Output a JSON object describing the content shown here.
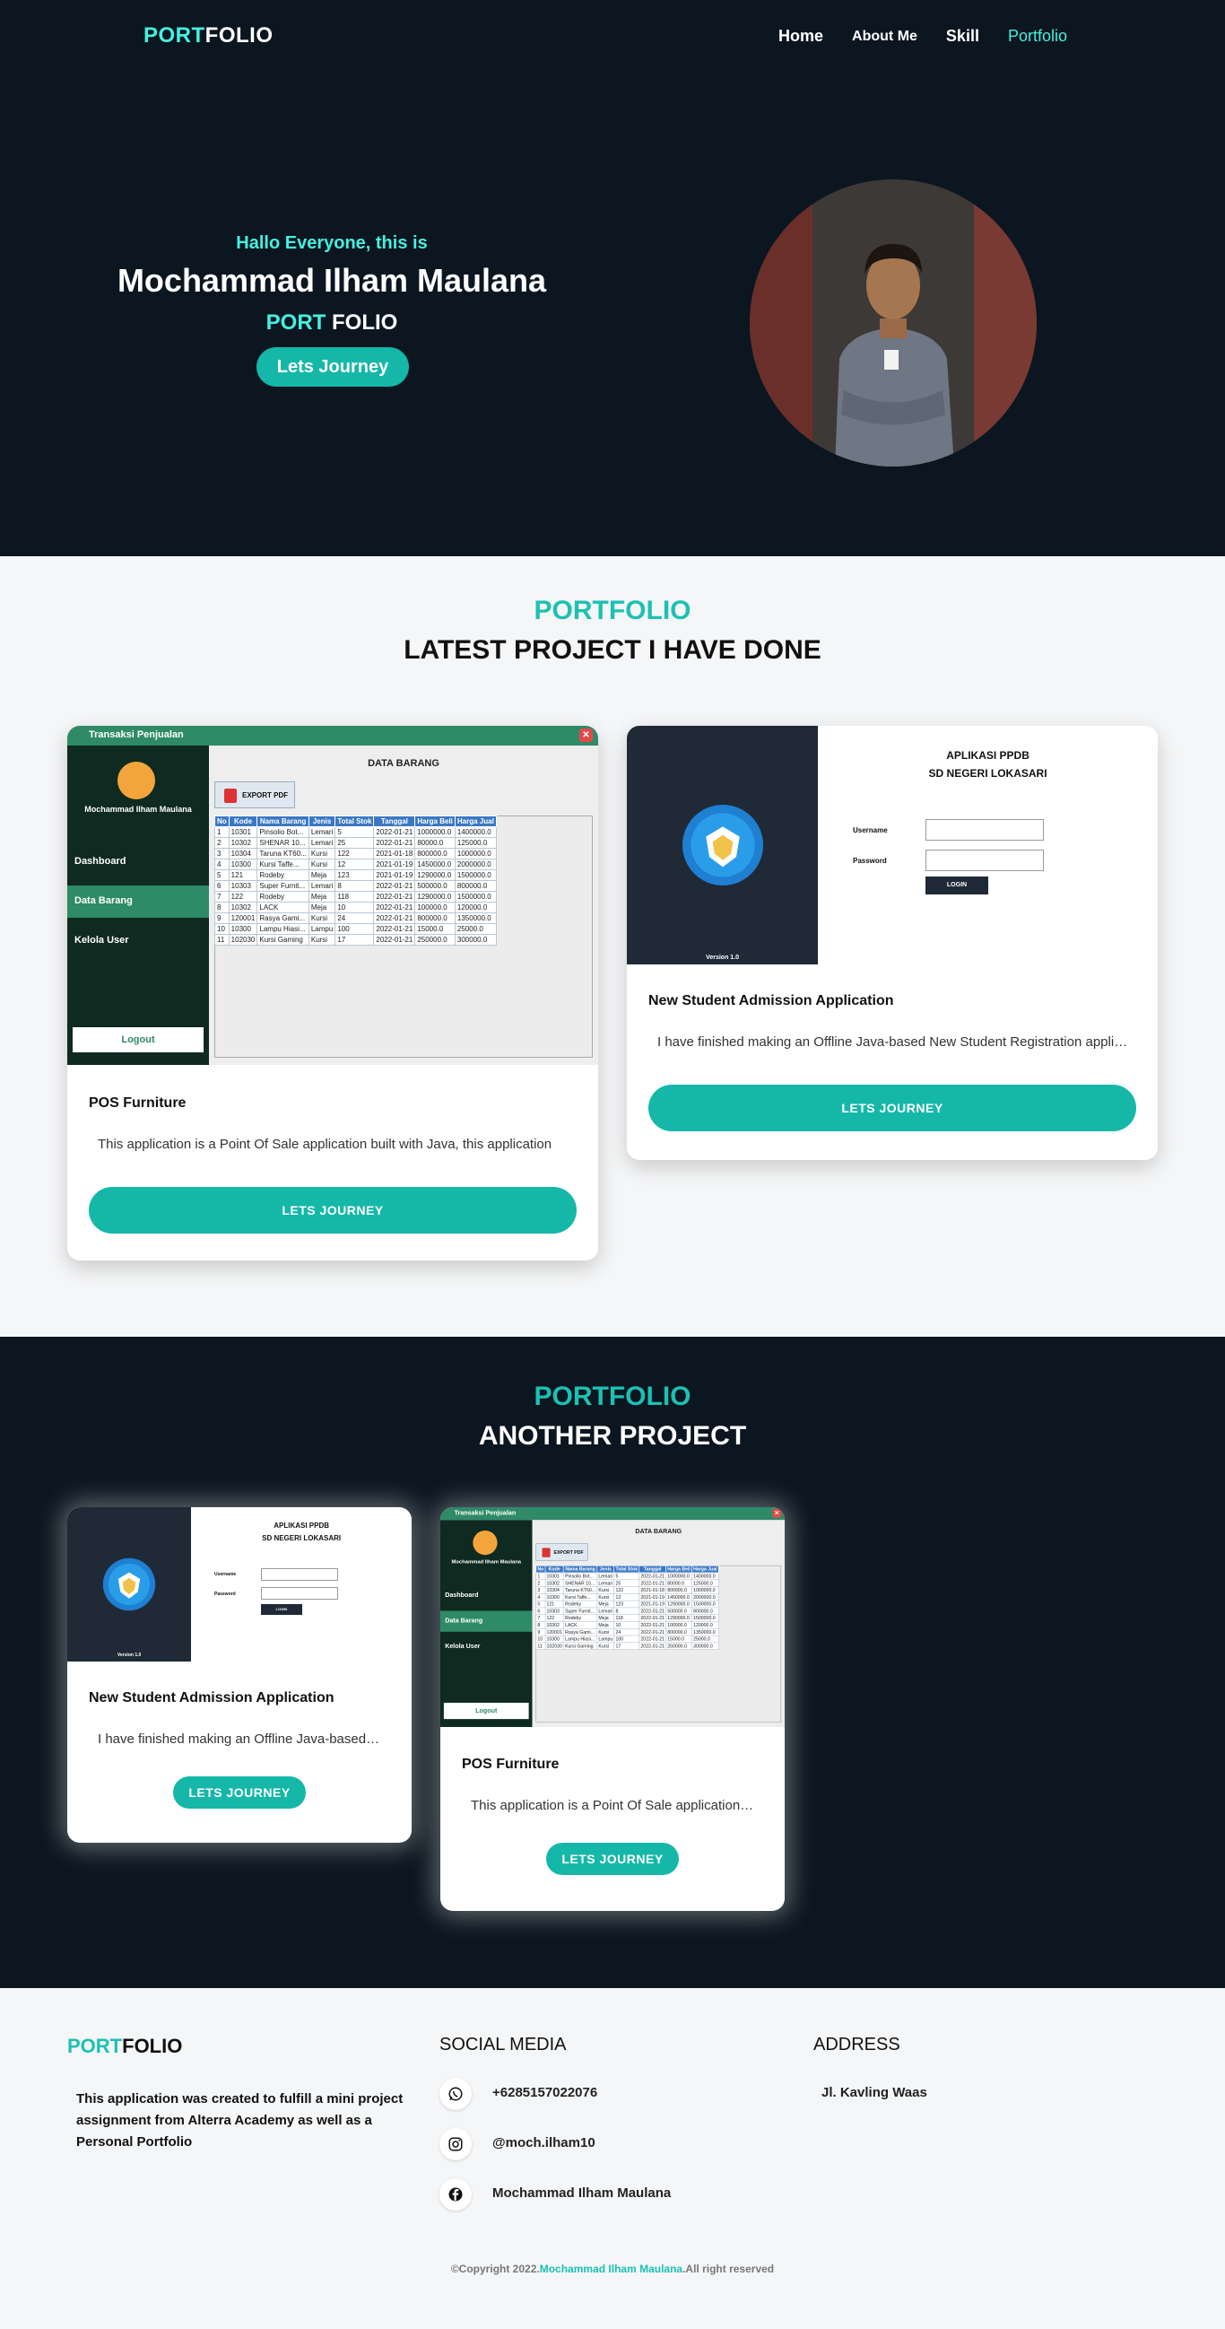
{
  "nav": {
    "logo_a": "PORT",
    "logo_b": "FOLIO",
    "links": [
      "Home",
      "About Me",
      "Skill",
      "Portfolio"
    ]
  },
  "hero": {
    "greeting": "Hallo Everyone, this is",
    "name": "Mochammad Ilham Maulana",
    "sub_a": "PORT",
    "sub_b": "FOLIO",
    "button": "Lets Journey"
  },
  "latest": {
    "kicker": "PORTFOLIO",
    "title": "LATEST PROJECT I HAVE DONE",
    "cards": [
      {
        "title": "POS Furniture",
        "desc": "This application is a Point Of Sale application built with Java, this application",
        "button": "LETS JOURNEY"
      },
      {
        "title": "New Student Admission Application",
        "desc": "I have finished making an Offline Java-based New Student Registration application",
        "button": "LETS JOURNEY"
      }
    ]
  },
  "another": {
    "kicker": "PORTFOLIO",
    "title": "ANOTHER PROJECT",
    "cards": [
      {
        "title": "New Student Admission Application",
        "desc": "I have finished making an Offline Java-based New Student Registration",
        "button": "LETS JOURNEY"
      },
      {
        "title": "POS Furniture",
        "desc": "This application is a Point Of Sale application built with Java",
        "button": "LETS JOURNEY"
      }
    ]
  },
  "pos_app": {
    "window_title": "Transaksi Penjualan",
    "user": "Mochammad Ilham Maulana",
    "menu": [
      "Dashboard",
      "Data Barang",
      "Kelola User"
    ],
    "logout": "Logout",
    "heading": "DATA BARANG",
    "export": "EXPORT PDF",
    "columns": [
      "No",
      "Kode",
      "Nama Barang",
      "Jenis",
      "Total Stok",
      "Tanggal",
      "Harga Beli",
      "Harga Jual"
    ],
    "rows": [
      [
        "1",
        "10301",
        "Pinsolio Bot...",
        "Lemari",
        "5",
        "2022-01-21",
        "1000000.0",
        "1400000.0"
      ],
      [
        "2",
        "10302",
        "SHENAR 10...",
        "Lemari",
        "25",
        "2022-01-21",
        "80000.0",
        "125000.0"
      ],
      [
        "3",
        "10304",
        "Taruna KT60...",
        "Kursi",
        "122",
        "2021-01-18",
        "800000.0",
        "1000000.0"
      ],
      [
        "4",
        "10300",
        "Kursi Taffe...",
        "Kursi",
        "12",
        "2021-01-19",
        "1450000.0",
        "2000000.0"
      ],
      [
        "5",
        "121",
        "Rodeby",
        "Meja",
        "123",
        "2021-01-19",
        "1290000.0",
        "1500000.0"
      ],
      [
        "6",
        "10303",
        "Super Furnit...",
        "Lemari",
        "8",
        "2022-01-21",
        "500000.0",
        "800000.0"
      ],
      [
        "7",
        "122",
        "Rodeby",
        "Meja",
        "118",
        "2022-01-21",
        "1290000.0",
        "1500000.0"
      ],
      [
        "8",
        "10302",
        "LACK",
        "Meja",
        "10",
        "2022-01-21",
        "100000.0",
        "120000.0"
      ],
      [
        "9",
        "120001",
        "Rasya Gami...",
        "Kursi",
        "24",
        "2022-01-21",
        "800000.0",
        "1350000.0"
      ],
      [
        "10",
        "10300",
        "Lampu Hiasi...",
        "Lampu",
        "100",
        "2022-01-21",
        "15000.0",
        "25000.0"
      ],
      [
        "11",
        "102030",
        "Kursi Gaming",
        "Kursi",
        "17",
        "2022-01-21",
        "250000.0",
        "300000.0"
      ]
    ]
  },
  "ppdb_app": {
    "title1": "APLIKASI PPDB",
    "title2": "SD NEGERI LOKASARI",
    "username": "Username",
    "password": "Password",
    "login": "LOGIN",
    "version": "Version 1.0"
  },
  "footer": {
    "logo_a": "PORT",
    "logo_b": "FOLIO",
    "description": "This application was created to fulfill a mini project assignment from Alterra Academy as well as a Personal Portfolio",
    "social_heading": "SOCIAL MEDIA",
    "social": [
      {
        "icon": "whatsapp-icon",
        "text": "+6285157022076"
      },
      {
        "icon": "instagram-icon",
        "text": "@moch.ilham10"
      },
      {
        "icon": "facebook-icon",
        "text": "Mochammad Ilham Maulana"
      }
    ],
    "address_heading": "ADDRESS",
    "address": "Jl. Kavling Waas",
    "copy_a": "©Copyright 2022.",
    "copy_name": "Mochammad Ilham Maulana",
    "copy_b": ".All right reserved"
  },
  "colors": {
    "accent": "#1cc1b3",
    "dark_bg": "#0c1620",
    "light_bg": "#f5f6f7",
    "button": "#15b8a8"
  }
}
